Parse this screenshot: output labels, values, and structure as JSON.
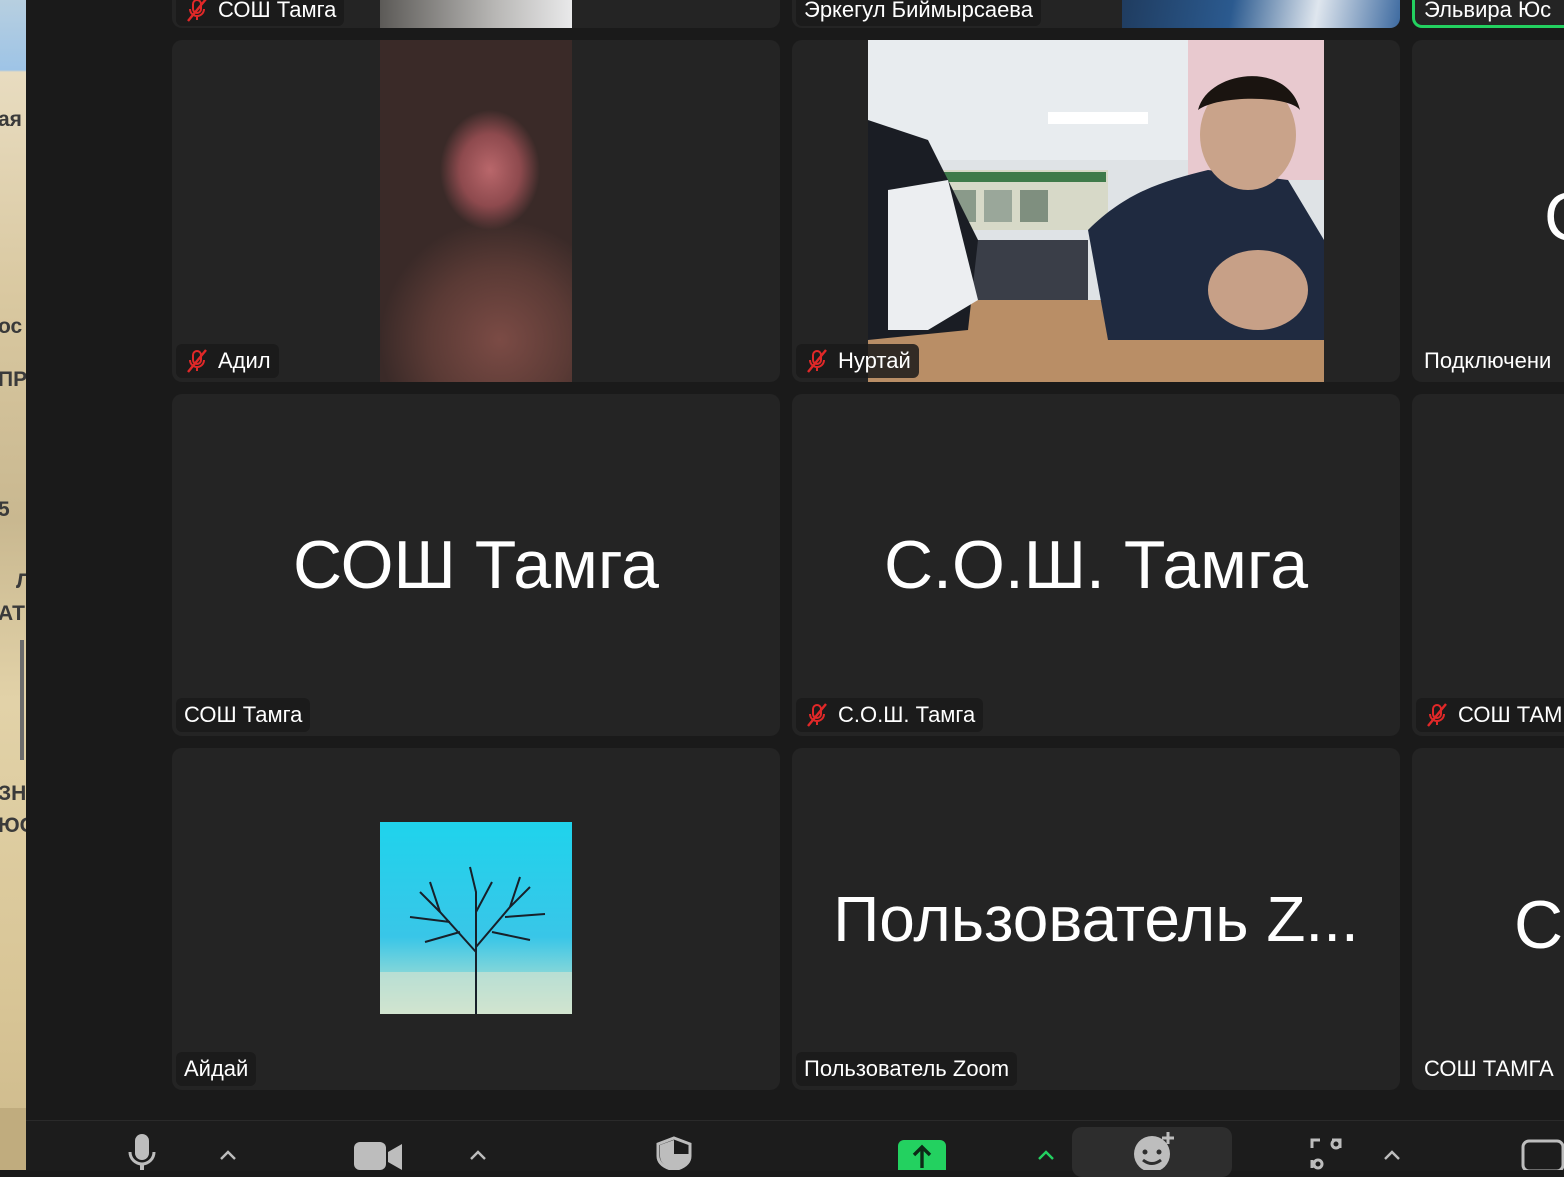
{
  "desktop": {
    "fragments": [
      "ая",
      "ос",
      "ПР",
      "5",
      "Л",
      "АТ",
      "ЗН",
      "ЮО"
    ]
  },
  "tiles": {
    "row0": {
      "left_name": "СОШ Тамга",
      "mid_name": "Эркегул Биймырсаева",
      "right_name": "Эльвира Юс"
    },
    "adil": {
      "name": "Адил"
    },
    "nurtai": {
      "name": "Нуртай"
    },
    "connecting": {
      "name": "Подключени",
      "big": "С"
    },
    "sosh_tamga": {
      "big": "СОШ Тамга",
      "name": "СОШ Тамга"
    },
    "s_o_sh_tamga": {
      "big": "С.О.Ш. Тамга",
      "name": "С.О.Ш. Тамга"
    },
    "sosh_tam_right": {
      "name": "СОШ ТАМ"
    },
    "aidai": {
      "name": "Айдай"
    },
    "zoom_user": {
      "big": "Пользователь Z...",
      "name": "Пользователь Zoom"
    },
    "sosh_tamga_caps": {
      "big": "С",
      "name": "СОШ ТАМГА"
    }
  },
  "toolbar": {
    "icons": [
      "microphone-icon",
      "video-camera-icon",
      "security-shield-icon",
      "share-screen-icon",
      "reactions-icon",
      "apps-icon",
      "chat-icon"
    ]
  },
  "colors": {
    "active_speaker": "#23d160",
    "share_green": "#23d160",
    "muted_red": "#e02828"
  }
}
